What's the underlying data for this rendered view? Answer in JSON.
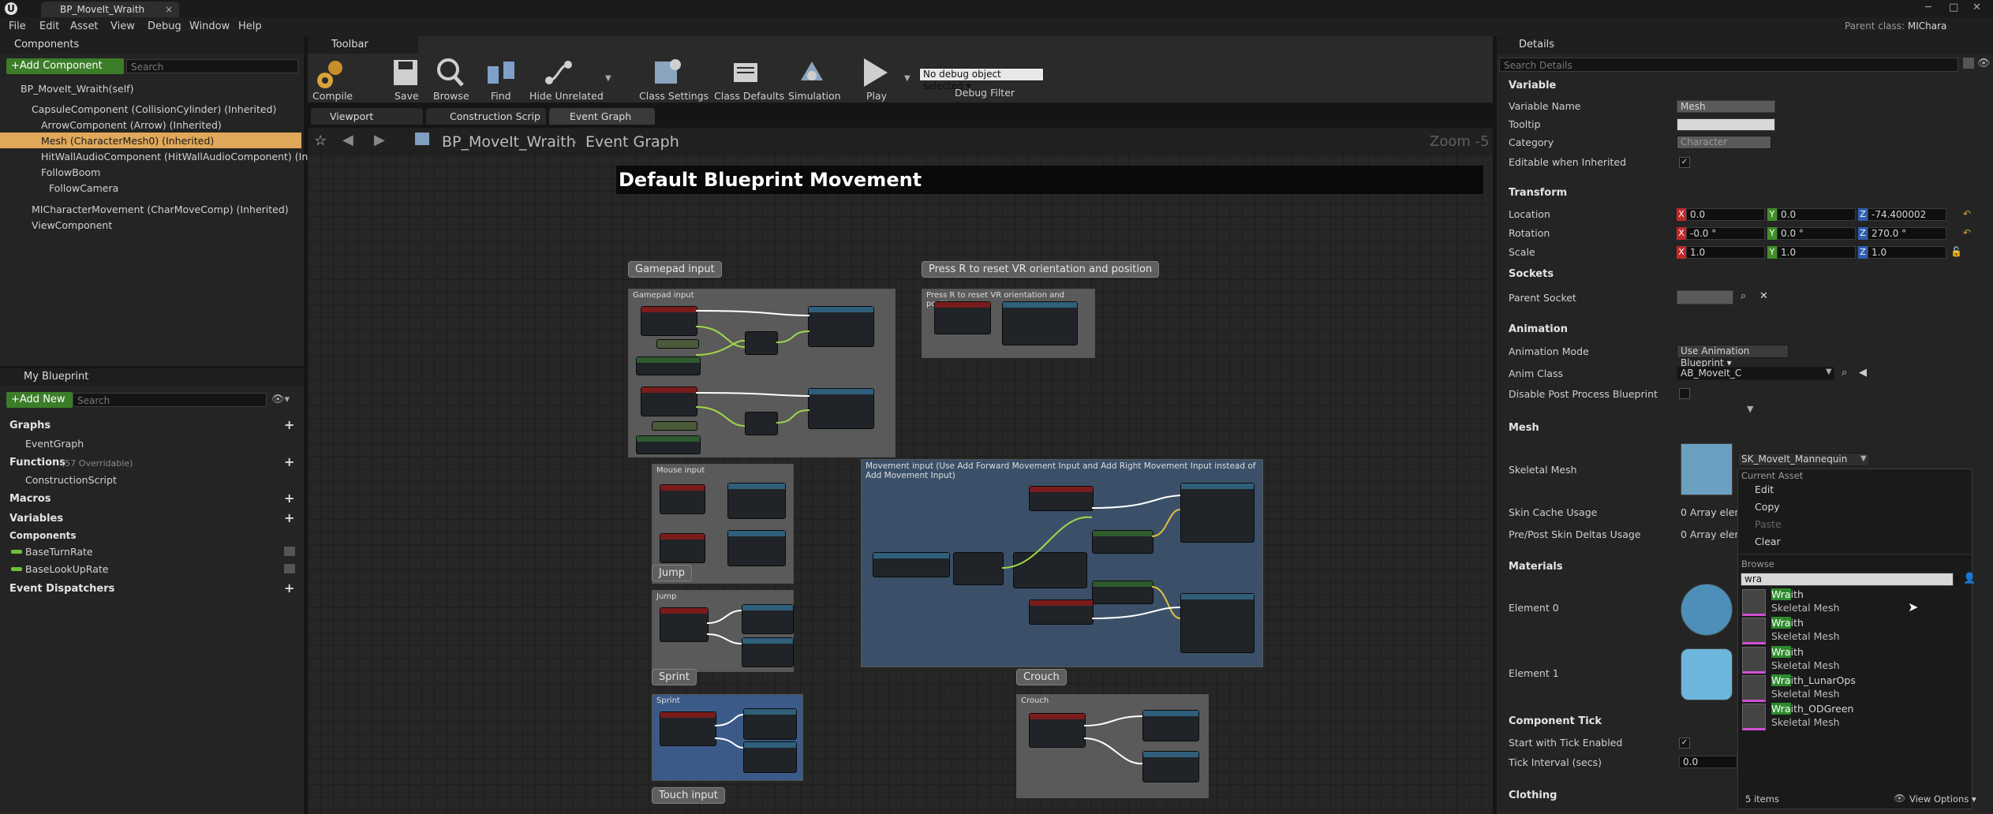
{
  "window": {
    "tab_title": "BP_MoveIt_Wraith",
    "parent_class_label": "Parent class:",
    "parent_class_value": "MIChara"
  },
  "menu": [
    "File",
    "Edit",
    "Asset",
    "View",
    "Debug",
    "Window",
    "Help"
  ],
  "components_panel": {
    "title": "Components",
    "add_button": "+Add Component",
    "search_placeholder": "Search",
    "root": "BP_MoveIt_Wraith(self)",
    "items": [
      "CapsuleComponent (CollisionCylinder) (Inherited)",
      "ArrowComponent (Arrow) (Inherited)",
      "Mesh (CharacterMesh0) (Inherited)",
      "HitWallAudioComponent (HitWallAudioComponent) (Inherited)",
      "FollowBoom",
      "FollowCamera",
      "MICharacterMovement (CharMoveComp) (Inherited)",
      "ViewComponent"
    ]
  },
  "my_blueprint": {
    "title": "My Blueprint",
    "add_button": "+Add New",
    "search_placeholder": "Search",
    "sections": {
      "graphs": "Graphs",
      "event_graph": "EventGraph",
      "functions": "Functions",
      "functions_count": "(57 Overridable)",
      "construction_script": "ConstructionScript",
      "macros": "Macros",
      "variables": "Variables",
      "components": "Components",
      "var1": "BaseTurnRate",
      "var2": "BaseLookUpRate",
      "event_dispatchers": "Event Dispatchers"
    }
  },
  "toolbar": {
    "title": "Toolbar",
    "buttons": [
      "Compile",
      "Save",
      "Browse",
      "Find",
      "Hide Unrelated",
      "Class Settings",
      "Class Defaults",
      "Simulation",
      "Play"
    ],
    "debug_select": "No debug object selected",
    "debug_label": "Debug Filter"
  },
  "editor_tabs": [
    "Viewport",
    "Construction Scrip",
    "Event Graph"
  ],
  "graph": {
    "breadcrumb_root": "BP_MoveIt_Wraith",
    "breadcrumb_graph": "Event Graph",
    "zoom": "Zoom -5",
    "title": "Default Blueprint Movement",
    "bubbles": {
      "gamepad": "Gamepad input",
      "vr": "Press R to reset VR orientation and position",
      "jump": "Jump",
      "sprint": "Sprint",
      "crouch": "Crouch",
      "touch": "Touch input"
    },
    "comments": {
      "gamepad": "Gamepad input",
      "vr": "Press R to reset VR orientation and position",
      "mouse": "Mouse input",
      "movement": "Movement input (Use Add Forward Movement Input and Add Right Movement Input instead of Add Movement Input)",
      "jump": "Jump",
      "sprint": "Sprint",
      "crouch": "Crouch"
    }
  },
  "details": {
    "title": "Details",
    "search_placeholder": "Search Details",
    "variable": {
      "header": "Variable",
      "name_label": "Variable Name",
      "name_value": "Mesh",
      "tooltip_label": "Tooltip",
      "category_label": "Category",
      "category_value": "Character",
      "editable_label": "Editable when Inherited"
    },
    "transform": {
      "header": "Transform",
      "location_label": "Location",
      "location": [
        "0.0",
        "0.0",
        "-74.400002"
      ],
      "rotation_label": "Rotation",
      "rotation": [
        "-0.0 °",
        "0.0 °",
        "270.0 °"
      ],
      "scale_label": "Scale",
      "scale": [
        "1.0",
        "1.0",
        "1.0"
      ]
    },
    "sockets": {
      "header": "Sockets",
      "parent_socket_label": "Parent Socket"
    },
    "animation": {
      "header": "Animation",
      "mode_label": "Animation Mode",
      "mode_value": "Use Animation Blueprint",
      "class_label": "Anim Class",
      "class_value": "AB_MoveIt_C",
      "disable_pp_label": "Disable Post Process Blueprint"
    },
    "mesh": {
      "header": "Mesh",
      "skeletal_label": "Skeletal Mesh",
      "skeletal_value": "SK_MoveIt_Mannequin",
      "skin_cache_label": "Skin Cache Usage",
      "skin_cache_value": "0 Array eleme",
      "prepost_label": "Pre/Post Skin Deltas Usage",
      "prepost_value": "0 Array eleme"
    },
    "materials": {
      "header": "Materials",
      "el0": "Element 0",
      "el1": "Element 1"
    },
    "component_tick": {
      "header": "Component Tick",
      "start_label": "Start with Tick Enabled",
      "interval_label": "Tick Interval (secs)",
      "interval_value": "0.0"
    },
    "clothing": {
      "header": "Clothing"
    }
  },
  "dropdown": {
    "current_asset": "Current Asset",
    "edit": "Edit",
    "copy": "Copy",
    "paste": "Paste",
    "clear": "Clear",
    "browse": "Browse",
    "search_value": "wra",
    "results": [
      {
        "match": "Wra",
        "rest": "ith",
        "type": "Skeletal Mesh"
      },
      {
        "match": "Wra",
        "rest": "ith",
        "type": "Skeletal Mesh"
      },
      {
        "match": "Wra",
        "rest": "ith",
        "type": "Skeletal Mesh"
      },
      {
        "match": "Wra",
        "rest": "ith_LunarOps",
        "type": "Skeletal Mesh"
      },
      {
        "match": "Wra",
        "rest": "ith_ODGreen",
        "type": "Skeletal Mesh"
      }
    ],
    "count": "5 items",
    "view_options": "View Options"
  },
  "colors": {
    "accent_green": "#3b7d28",
    "selection": "#e0a85a",
    "x": "#c0282a",
    "y": "#3f8f28",
    "z": "#2f5fb0",
    "match_highlight": "#2e8a2e"
  }
}
